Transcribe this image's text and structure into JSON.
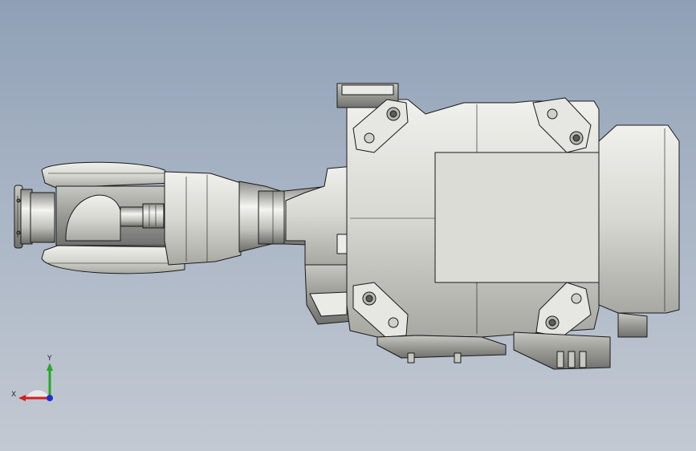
{
  "viewport": {
    "background_top": "#8fa0b6",
    "background_bottom": "#c3c9d2",
    "model_fill": "#dcdcd6",
    "model_edge": "#1a1a1a"
  },
  "model": {
    "parts": [
      "wrist-flange",
      "wrist-fork",
      "forearm",
      "elbow-housing",
      "motor-block",
      "base-flange"
    ]
  },
  "triad": {
    "x_label": "X",
    "y_label": "Y",
    "x_color": "#d42020",
    "y_color": "#22aa22",
    "z_color": "#2030d0"
  }
}
